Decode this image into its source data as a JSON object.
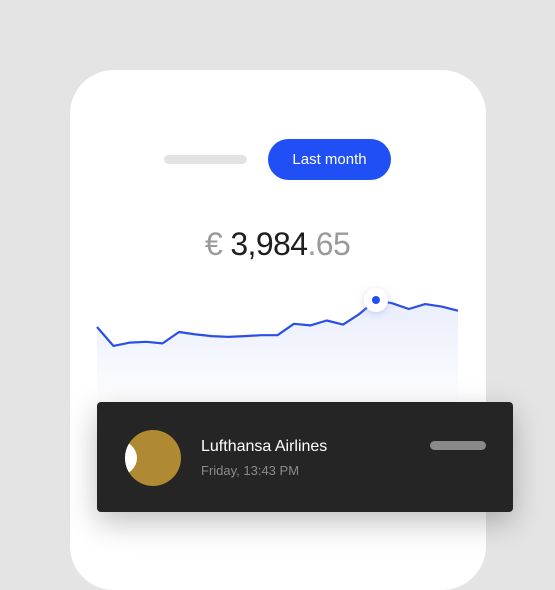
{
  "header": {
    "period_button_label": "Last month"
  },
  "balance": {
    "currency": "€",
    "whole": "3,984",
    "cents": ".65"
  },
  "chart_data": {
    "type": "area",
    "x": [
      0,
      1,
      2,
      3,
      4,
      5,
      6,
      7,
      8,
      9,
      10,
      11,
      12,
      13,
      14,
      15,
      16,
      17,
      18,
      19,
      20,
      21,
      22
    ],
    "values": [
      28,
      5,
      9,
      10,
      8,
      22,
      19,
      17,
      16,
      17,
      18,
      18,
      32,
      30,
      36,
      31,
      44,
      61,
      57,
      50,
      56,
      53,
      48
    ],
    "highlight_index": 17,
    "grid": false,
    "colors": {
      "line": "#2a4ee8",
      "fill": "#eef1fd",
      "marker": "#1f4ff5"
    }
  },
  "notification": {
    "merchant": "Lufthansa Airlines",
    "time": "Friday, 13:43 PM",
    "logo_icon": "lufthansa-crane-logo"
  }
}
